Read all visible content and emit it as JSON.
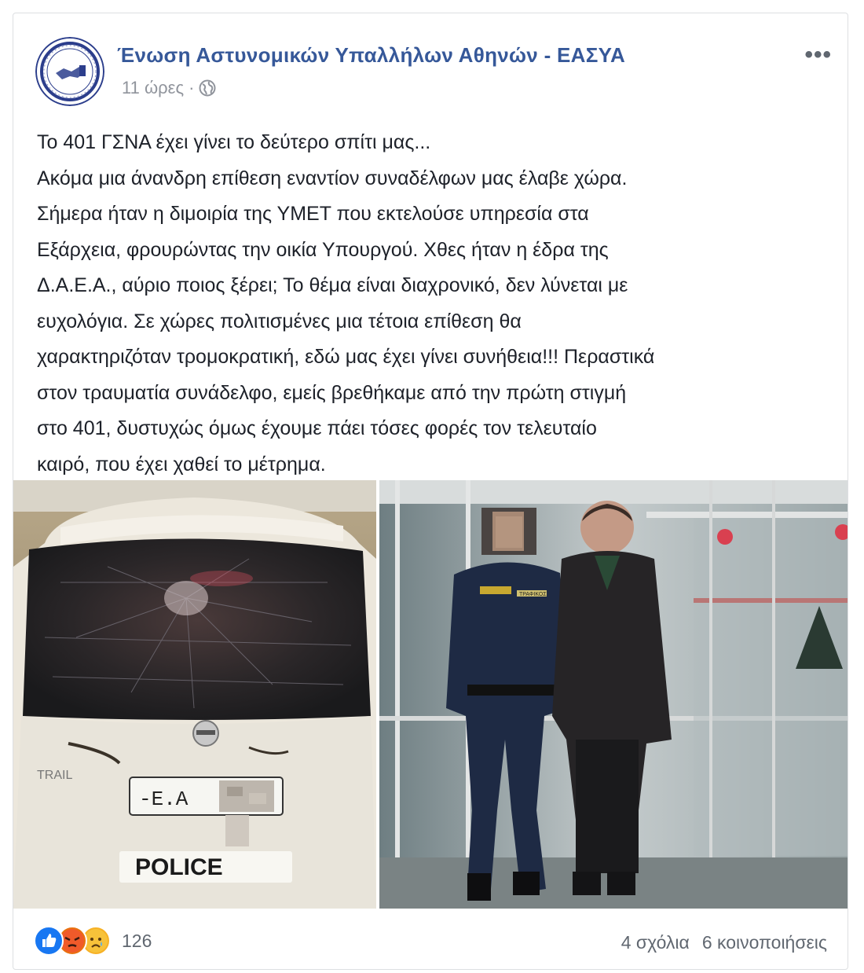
{
  "post": {
    "page_name": "Ένωση Αστυνομικών Υπαλλήλων Αθηνών - ΕΑΣΥΑ",
    "time": "11 ώρες",
    "separator": "·",
    "audience_icon": "globe-icon",
    "more_icon": "•••",
    "lines": [
      "Το 401 ΓΣΝΑ έχει γίνει το δεύτερο σπίτι μας...",
      "Ακόμα μια άνανδρη επίθεση εναντίον συναδέλφων μας έλαβε χώρα.",
      "Σήμερα ήταν η διμοιρία της ΥΜΕΤ που εκτελούσε υπηρεσία στα",
      "Εξάρχεια, φρουρώντας την οικία Υπουργού. Χθες ήταν η έδρα της",
      "Δ.Α.Ε.Α., αύριο ποιος ξέρει; Το θέμα είναι διαχρονικό, δεν λύνεται με",
      "ευχολόγια. Σε χώρες πολιτισμένες μια τέτοια επίθεση θα",
      "χαρακτηριζόταν τρομοκρατική, εδώ μας έχει γίνει συνήθεια!!! Περαστικά",
      "στον τραυματία συνάδελφο, εμείς βρεθήκαμε από την πρώτη στιγμή",
      "στο 401, δυστυχώς όμως έχουμε πάει τόσες φορές τον τελευταίο",
      "καιρό, που έχει χαθεί το μέτρημα."
    ]
  },
  "photos": {
    "left": {
      "plate_text": "-E.A",
      "trail_text": "TRAIL",
      "police_text": "POLICE",
      "badge_text": "ΤΡΑΦΙΚΟΣ"
    }
  },
  "footer": {
    "reaction_icons": [
      "like-icon",
      "angry-icon",
      "sad-icon"
    ],
    "reaction_count": "126",
    "comments": "4 σχόλια",
    "shares": "6 κοινοποιήσεις"
  },
  "colors": {
    "page_name": "#365899",
    "text": "#1d2129",
    "meta": "#90949c",
    "like": "#1877f2",
    "angry": "#e9710f",
    "sad": "#f7b125"
  }
}
